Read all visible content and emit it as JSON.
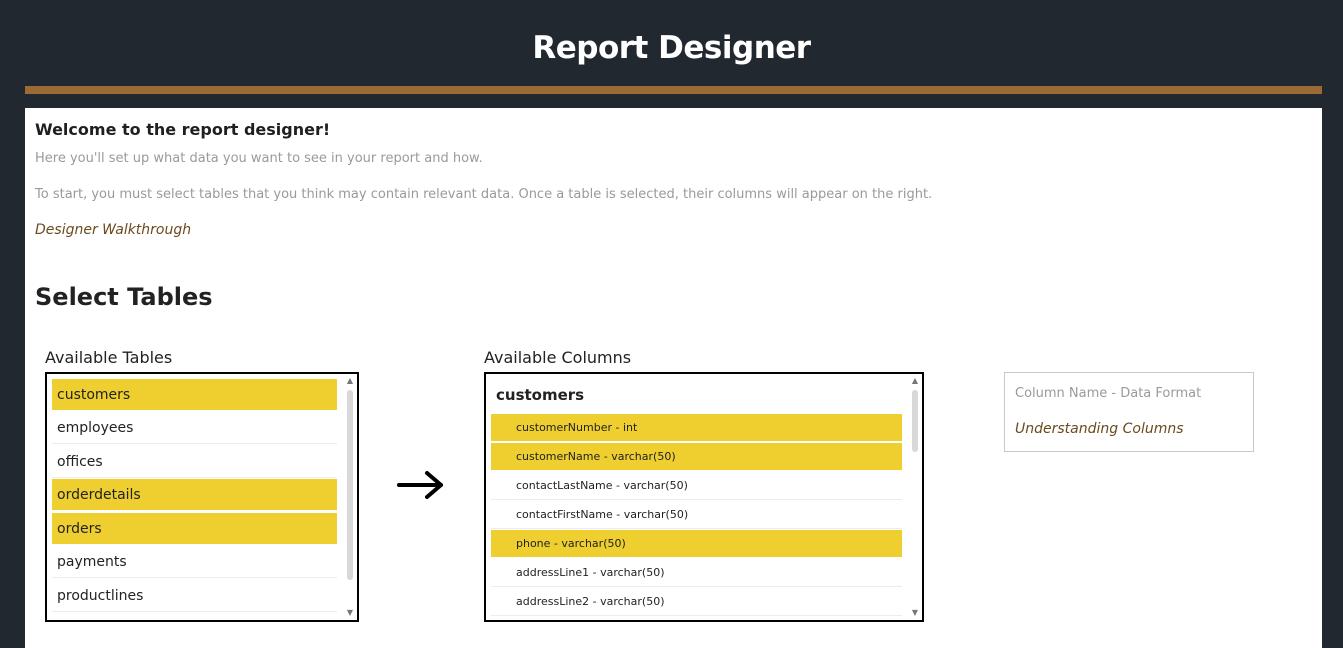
{
  "header": {
    "title": "Report Designer"
  },
  "intro": {
    "welcome": "Welcome to the report designer!",
    "line1": "Here you'll set up what data you want to see in your report and how.",
    "line2": "To start, you must select tables that you think may contain relevant data. Once a table is selected, their columns will appear on the right.",
    "walkthrough_link": "Designer Walkthrough"
  },
  "section": {
    "title": "Select Tables"
  },
  "tables": {
    "label": "Available Tables",
    "items": [
      {
        "name": "customers",
        "selected": true
      },
      {
        "name": "employees",
        "selected": false
      },
      {
        "name": "offices",
        "selected": false
      },
      {
        "name": "orderdetails",
        "selected": true
      },
      {
        "name": "orders",
        "selected": true
      },
      {
        "name": "payments",
        "selected": false
      },
      {
        "name": "productlines",
        "selected": false
      }
    ]
  },
  "columns": {
    "label": "Available Columns",
    "group_title": "customers",
    "items": [
      {
        "name": "customerNumber - int",
        "selected": true
      },
      {
        "name": "customerName - varchar(50)",
        "selected": true
      },
      {
        "name": "contactLastName - varchar(50)",
        "selected": false
      },
      {
        "name": "contactFirstName - varchar(50)",
        "selected": false
      },
      {
        "name": "phone - varchar(50)",
        "selected": true
      },
      {
        "name": "addressLine1 - varchar(50)",
        "selected": false
      },
      {
        "name": "addressLine2 - varchar(50)",
        "selected": false
      }
    ]
  },
  "info": {
    "label": "Column Name - Data Format",
    "link": "Understanding Columns"
  },
  "icons": {
    "arrow": "arrow-right-icon",
    "scroll_up": "chevron-up-icon",
    "scroll_down": "chevron-down-icon"
  },
  "colors": {
    "background": "#212830",
    "accent": "#9c6a35",
    "selection": "#efcf30",
    "link": "#6b4a1d"
  }
}
